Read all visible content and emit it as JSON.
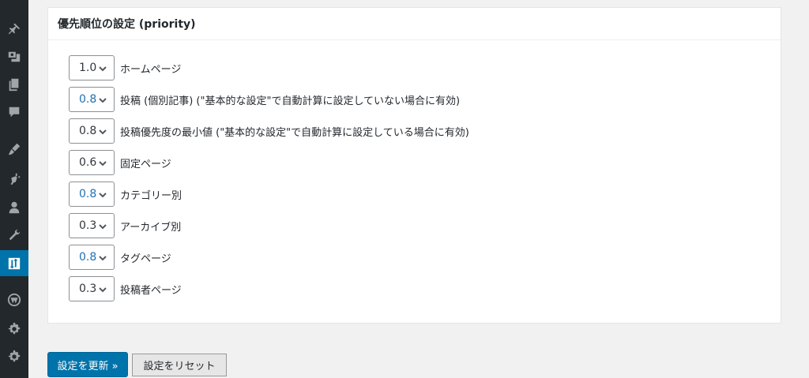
{
  "sidebar": {
    "icons": [
      {
        "name": "pin-icon"
      },
      {
        "name": "media-icon"
      },
      {
        "name": "pages-icon"
      },
      {
        "name": "comments-icon"
      },
      {
        "name": "appearance-icon"
      },
      {
        "name": "plugins-icon"
      },
      {
        "name": "users-icon"
      },
      {
        "name": "tools-icon"
      },
      {
        "name": "settings-sort-icon",
        "active": true
      },
      {
        "name": "wordpress-icon"
      },
      {
        "name": "gear-icon"
      },
      {
        "name": "gear-icon-2"
      }
    ]
  },
  "panel": {
    "title": "優先順位の設定 (priority)",
    "rows": [
      {
        "value": "1.0",
        "label": "ホームページ",
        "highlight": false
      },
      {
        "value": "0.8",
        "label": "投稿 (個別記事) (\"基本的な設定\"で自動計算に設定していない場合に有効)",
        "highlight": true
      },
      {
        "value": "0.8",
        "label": "投稿優先度の最小値 (\"基本的な設定\"で自動計算に設定している場合に有効)",
        "highlight": false
      },
      {
        "value": "0.6",
        "label": "固定ページ",
        "highlight": false
      },
      {
        "value": "0.8",
        "label": "カテゴリー別",
        "highlight": true
      },
      {
        "value": "0.3",
        "label": "アーカイブ別",
        "highlight": false
      },
      {
        "value": "0.8",
        "label": "タグページ",
        "highlight": true
      },
      {
        "value": "0.3",
        "label": "投稿者ページ",
        "highlight": false
      }
    ]
  },
  "buttons": {
    "update_label": "設定を更新 »",
    "reset_label": "設定をリセット"
  },
  "colors": {
    "sidebar_bg": "#23282d",
    "accent": "#0073aa",
    "select_blue_text": "#2271b1"
  }
}
